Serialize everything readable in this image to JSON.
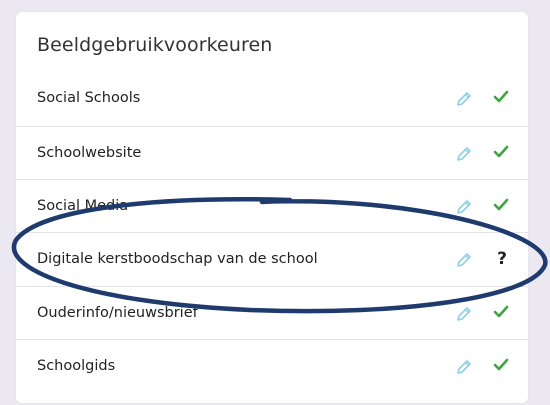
{
  "card": {
    "title": "Beeldgebruikvoorkeuren"
  },
  "rows": [
    {
      "label": "Social Schools",
      "status": "check",
      "edit_icon": "pencil-icon"
    },
    {
      "label": "Schoolwebsite",
      "status": "check",
      "edit_icon": "pencil-icon"
    },
    {
      "label": "Social Media",
      "status": "check",
      "edit_icon": "pencil-icon"
    },
    {
      "label": "Digitale kerstboodschap van de school",
      "status": "question",
      "status_text": "?",
      "edit_icon": "pencil-icon"
    },
    {
      "label": "Ouderinfo/nieuwsbrief",
      "status": "check",
      "edit_icon": "pencil-icon"
    },
    {
      "label": "Schoolgids",
      "status": "check",
      "edit_icon": "pencil-icon"
    }
  ],
  "colors": {
    "background": "#ebe8f2",
    "check": "#3ea53e",
    "pencil": "#8fcfe6",
    "highlight": "#1f3b6e"
  }
}
